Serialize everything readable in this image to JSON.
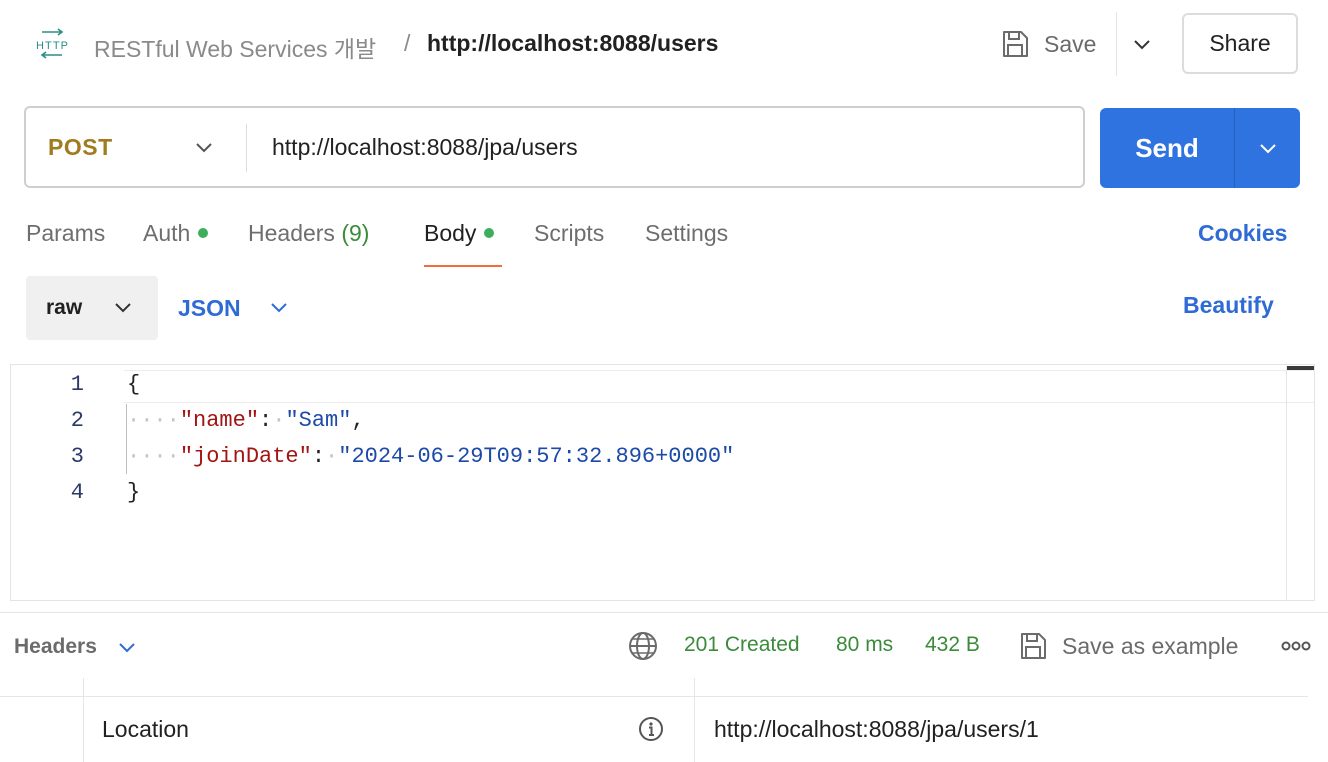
{
  "header": {
    "icon": "http-icon",
    "breadcrumb_parent": "RESTful Web Services 개발",
    "breadcrumb_separator": "/",
    "breadcrumb_current": "http://localhost:8088/users",
    "save_label": "Save",
    "share_label": "Share"
  },
  "request": {
    "method": "POST",
    "url": "http://localhost:8088/jpa/users",
    "send_label": "Send"
  },
  "tabs": {
    "params": "Params",
    "auth": "Auth",
    "headers": "Headers",
    "headers_count": "(9)",
    "body": "Body",
    "scripts": "Scripts",
    "settings": "Settings",
    "active": "Body",
    "cookies": "Cookies"
  },
  "body_options": {
    "mode": "raw",
    "format": "JSON",
    "beautify": "Beautify"
  },
  "editor": {
    "line_numbers": [
      "1",
      "2",
      "3",
      "4"
    ],
    "line1": "{",
    "line2_ws": "····",
    "line2_key": "\"name\"",
    "line2_colon": ":",
    "line2_ws2": "·",
    "line2_value": "\"Sam\"",
    "line2_comma": ",",
    "line3_ws": "····",
    "line3_key": "\"joinDate\"",
    "line3_colon": ":",
    "line3_ws2": "·",
    "line3_value": "\"2024-06-29T09:57:32.896+0000\"",
    "line4": "}"
  },
  "response": {
    "section_label": "Headers",
    "status": "201 Created",
    "time": "80 ms",
    "size": "432 B",
    "save_example": "Save as example",
    "headers": [
      {
        "key": "Location",
        "value": "http://localhost:8088/jpa/users/1"
      }
    ]
  },
  "colors": {
    "send": "#2f73e0",
    "method_post": "#a27b1e",
    "link": "#2f6bd4",
    "success": "#3a8b3a",
    "active_tab_underline": "#f26b3a"
  }
}
